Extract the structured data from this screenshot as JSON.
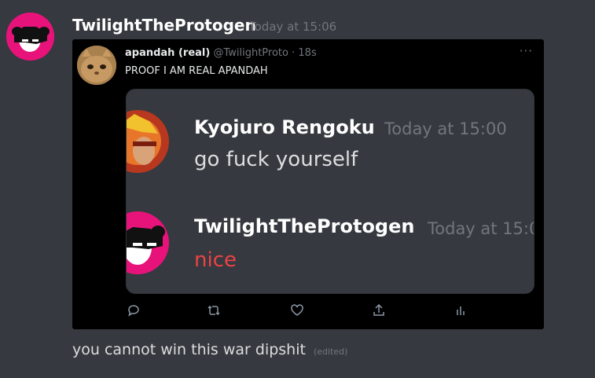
{
  "message": {
    "author": "TwilightTheProtogen",
    "timestamp": "Today at 15:06",
    "content": "you cannot win this war dipshit",
    "edited_label": "(edited)"
  },
  "tweet": {
    "display_name": "apandah (real)",
    "handle": "@TwilightProto",
    "separator": "·",
    "time": "18s",
    "text": "PROOF I AM REAL APANDAH",
    "more": "···",
    "actions": [
      "reply-icon",
      "retweet-icon",
      "like-icon",
      "share-icon",
      "stats-icon"
    ]
  },
  "screenshot": {
    "messages": [
      {
        "author": "Kyojuro Rengoku",
        "timestamp": "Today at 15:00",
        "text": "go fuck yourself"
      },
      {
        "author": "TwilightTheProtogen",
        "timestamp": "Today at 15:0",
        "text": "nice"
      }
    ]
  },
  "colors": {
    "background": "#36393f",
    "embed_background": "#000000",
    "avatar_pink": "#e8137a",
    "muted": "#72767d",
    "red_text": "#ed4245"
  }
}
